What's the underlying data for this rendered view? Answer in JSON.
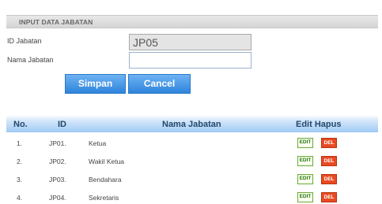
{
  "form": {
    "title": "INPUT DATA JABATAN",
    "id_label": "ID Jabatan",
    "id_value": "JP05",
    "name_label": "Nama Jabatan",
    "name_value": "",
    "save_label": "Simpan",
    "cancel_label": "Cancel"
  },
  "table": {
    "headers": {
      "no": "No.",
      "id": "ID",
      "name": "Nama Jabatan",
      "edit_delete": "Edit Hapus"
    },
    "rows": [
      {
        "no": "1.",
        "id": "JP01.",
        "name": "Ketua",
        "edit": "EDIT",
        "del": "DEL"
      },
      {
        "no": "2.",
        "id": "JP02.",
        "name": "Wakil Ketua",
        "edit": "EDIT",
        "del": "DEL"
      },
      {
        "no": "3.",
        "id": "JP03.",
        "name": "Bendahara",
        "edit": "EDIT",
        "del": "DEL"
      },
      {
        "no": "4.",
        "id": "JP04.",
        "name": "Sekretaris",
        "edit": "EDIT",
        "del": "DEL"
      }
    ]
  }
}
